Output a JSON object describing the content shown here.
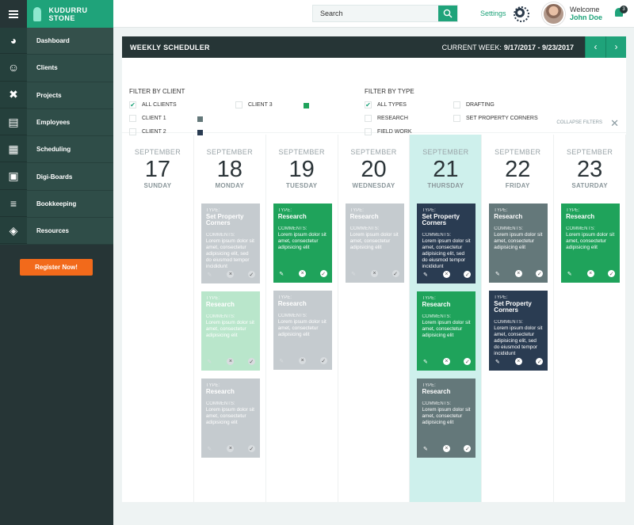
{
  "brand": {
    "name": "KUDURRU STONE"
  },
  "search": {
    "placeholder": "Search"
  },
  "header": {
    "settings_label": "Settings",
    "welcome_label": "Welcome",
    "user_name": "John Doe",
    "notification_count": "3"
  },
  "sidebar": {
    "items": [
      {
        "label": "Dashboard",
        "icon": "dashboard-icon"
      },
      {
        "label": "Clients",
        "icon": "users-icon"
      },
      {
        "label": "Projects",
        "icon": "tools-icon"
      },
      {
        "label": "Employees",
        "icon": "id-card-icon"
      },
      {
        "label": "Scheduling",
        "icon": "calendar-icon"
      },
      {
        "label": "Digi-Boards",
        "icon": "board-icon"
      },
      {
        "label": "Bookkeeping",
        "icon": "ledger-icon"
      },
      {
        "label": "Resources",
        "icon": "boxes-icon"
      }
    ],
    "register_label": "Register Now!"
  },
  "scheduler": {
    "title": "WEEKLY SCHEDULER",
    "week_label": "CURRENT WEEK:",
    "week_range": "9/17/2017 - 9/23/2017"
  },
  "filters": {
    "client_title": "FILTER BY CLIENT",
    "type_title": "FILTER BY TYPE",
    "clients": [
      {
        "label": "ALL CLIENTS",
        "checked": true
      },
      {
        "label": "CLIENT 1",
        "checked": false,
        "color": "#64787a"
      },
      {
        "label": "CLIENT 2",
        "checked": false,
        "color": "#2a3c52"
      },
      {
        "label": "CLIENT 3",
        "checked": false,
        "color": "#1fa35b"
      }
    ],
    "types": [
      {
        "label": "ALL TYPES",
        "checked": true
      },
      {
        "label": "RESEARCH",
        "checked": false
      },
      {
        "label": "FIELD WORK",
        "checked": false
      },
      {
        "label": "DRAFTING",
        "checked": false
      },
      {
        "label": "SET PROPERTY CORNERS",
        "checked": false
      }
    ],
    "collapse_label": "COLLAPSE FILTERS"
  },
  "card_labels": {
    "type": "TYPE:",
    "comments": "COMMENTS:"
  },
  "days": [
    {
      "month": "SEPTEMBER",
      "num": "17",
      "name": "SUNDAY",
      "today": false,
      "cards": []
    },
    {
      "month": "SEPTEMBER",
      "num": "18",
      "name": "MONDAY",
      "today": false,
      "cards": [
        {
          "type": "Set Property Corners",
          "comment": "Lorem ipsum dolor sit amet, consectetur adipisicing elit, sed do eiusmod tempor incididunt",
          "color": "grey"
        },
        {
          "type": "Research",
          "comment": "Lorem ipsum dolor sit amet, consectetur adipisicing elit",
          "color": "mint"
        },
        {
          "type": "Research",
          "comment": "Lorem ipsum dolor sit amet, consectetur adipisicing elit",
          "color": "grey"
        }
      ]
    },
    {
      "month": "SEPTEMBER",
      "num": "19",
      "name": "TUESDAY",
      "today": false,
      "cards": [
        {
          "type": "Research",
          "comment": "Lorem ipsum dolor sit amet, consectetur adipisicing elit",
          "color": "green"
        },
        {
          "type": "Research",
          "comment": "Lorem ipsum dolor sit amet, consectetur adipisicing elit",
          "color": "grey"
        }
      ]
    },
    {
      "month": "SEPTEMBER",
      "num": "20",
      "name": "WEDNESDAY",
      "today": false,
      "cards": [
        {
          "type": "Research",
          "comment": "Lorem ipsum dolor sit amet, consectetur adipisicing elit",
          "color": "grey"
        }
      ]
    },
    {
      "month": "SEPTEMBER",
      "num": "21",
      "name": "THURSDAY",
      "today": true,
      "cards": [
        {
          "type": "Set Property Corners",
          "comment": "Lorem ipsum dolor sit amet, consectetur adipisicing elit, sed do eiusmod tempor incididunt",
          "color": "navy"
        },
        {
          "type": "Research",
          "comment": "Lorem ipsum dolor sit amet, consectetur adipisicing elit",
          "color": "green"
        },
        {
          "type": "Research",
          "comment": "Lorem ipsum dolor sit amet, consectetur adipisicing elit",
          "color": "slate"
        }
      ]
    },
    {
      "month": "SEPTEMBER",
      "num": "22",
      "name": "FRIDAY",
      "today": false,
      "cards": [
        {
          "type": "Research",
          "comment": "Lorem ipsum dolor sit amet, consectetur adipisicing elit",
          "color": "slate"
        },
        {
          "type": "Set Property Corners",
          "comment": "Lorem ipsum dolor sit amet, consectetur adipisicing elit, sed do eiusmod tempor incididunt",
          "color": "navy"
        }
      ]
    },
    {
      "month": "SEPTEMBER",
      "num": "23",
      "name": "SATURDAY",
      "today": false,
      "cards": [
        {
          "type": "Research",
          "comment": "Lorem ipsum dolor sit amet, consectetur adipisicing elit",
          "color": "green"
        }
      ]
    }
  ]
}
